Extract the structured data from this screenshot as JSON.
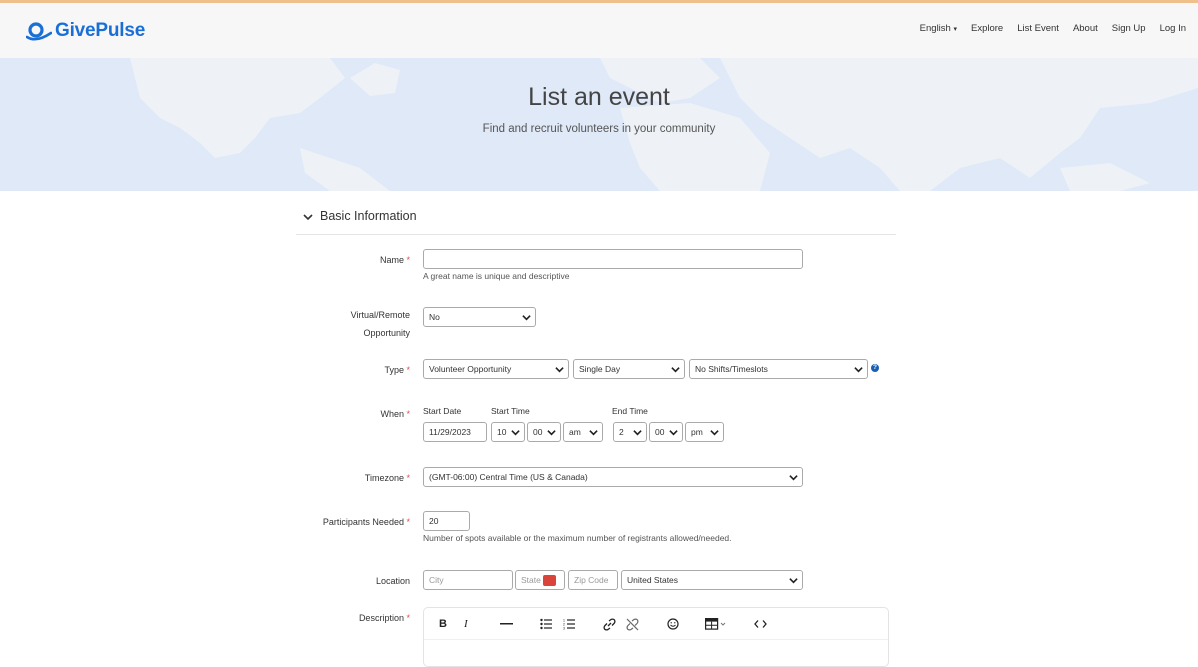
{
  "nav": {
    "brand": "GivePulse",
    "links": [
      "English",
      "Explore",
      "List Event",
      "About",
      "Sign Up",
      "Log In"
    ]
  },
  "hero": {
    "title": "List an event",
    "subtitle": "Find and recruit volunteers in your community"
  },
  "section": {
    "title": "Basic Information"
  },
  "form": {
    "name": {
      "label": "Name",
      "required": "*",
      "value": "",
      "help": "A great name is unique and descriptive"
    },
    "virtual": {
      "label_line1": "Virtual/Remote",
      "label_line2": "Opportunity",
      "value": "No"
    },
    "type": {
      "label": "Type",
      "required": "*",
      "kind": "Volunteer Opportunity",
      "duration": "Single Day",
      "shifts": "No Shifts/Timeslots",
      "help_icon": "?"
    },
    "when": {
      "label": "When",
      "required": "*",
      "start_date_label": "Start Date",
      "start_time_label": "Start Time",
      "end_time_label": "End Time",
      "start_date": "11/29/2023",
      "start_hour": "10",
      "start_minute": "00",
      "start_ampm": "am",
      "end_hour": "2",
      "end_minute": "00",
      "end_ampm": "pm"
    },
    "timezone": {
      "label": "Timezone",
      "required": "*",
      "value": "(GMT-06:00) Central Time (US & Canada)"
    },
    "participants": {
      "label": "Participants Needed",
      "required": "*",
      "value": "20",
      "help": "Number of spots available or the maximum number of registrants allowed/needed."
    },
    "location": {
      "label": "Location",
      "city_placeholder": "City",
      "state_placeholder": "State",
      "zip_placeholder": "Zip Code",
      "country": "United States"
    },
    "description": {
      "label": "Description",
      "required": "*"
    }
  },
  "colors": {
    "brand": "#1a6fd6",
    "hero_bg": "#dfe9f8",
    "required": "#d9534f",
    "help_icon": "#1a5fb4"
  }
}
